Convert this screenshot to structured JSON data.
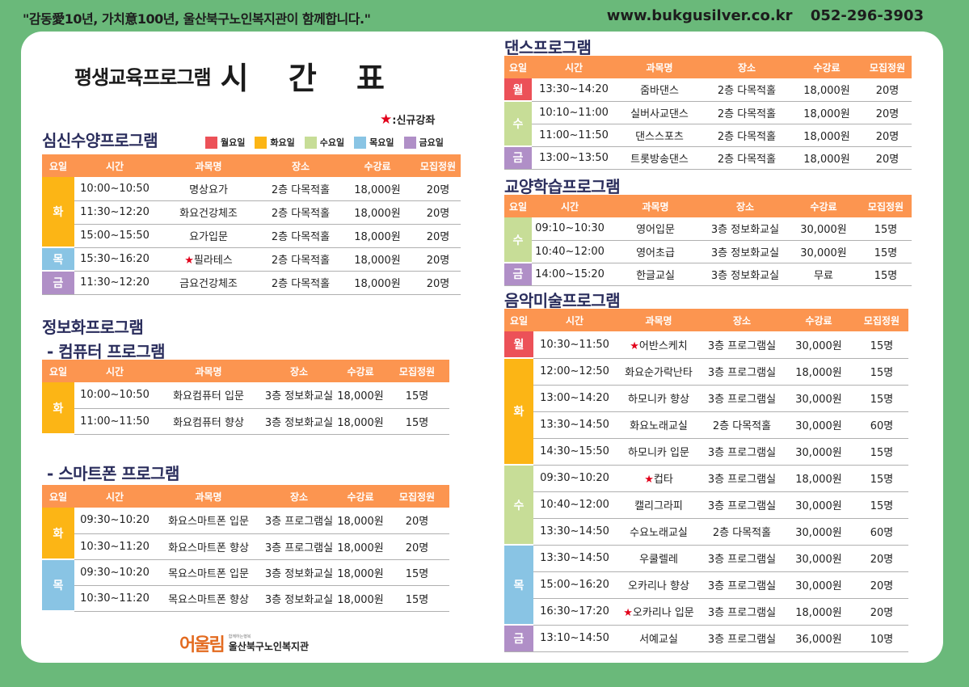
{
  "header": {
    "slogan": "\"감동愛10년, 가치意100년, 울산북구노인복지관이 함께합니다.\"",
    "website": "www.bukgusilver.co.kr",
    "phone": "052-296-3903"
  },
  "title": {
    "sub": "평생교육프로그램",
    "main": "시 간 표"
  },
  "new_note": {
    "star": "★",
    "label": ":신규강좌"
  },
  "legend": [
    {
      "label": "월요일",
      "color": "#ec5158"
    },
    {
      "label": "화요일",
      "color": "#fcb515"
    },
    {
      "label": "수요일",
      "color": "#c7dd97"
    },
    {
      "label": "목요일",
      "color": "#89c4e4"
    },
    {
      "label": "금요일",
      "color": "#b08fc7"
    }
  ],
  "columns": {
    "day": "요일",
    "time": "시간",
    "course": "과목명",
    "place": "장소",
    "fee": "수강료",
    "capacity": "모집정원"
  },
  "sections": {
    "mind_body": {
      "title": "심신수양프로그램",
      "groups": [
        {
          "day": "화",
          "color": "tue",
          "rows": [
            {
              "time": "10:00~10:50",
              "course": "명상요가",
              "place": "2층 다목적홀",
              "fee": "18,000원",
              "cap": "20명"
            },
            {
              "time": "11:30~12:20",
              "course": "화요건강체조",
              "place": "2층 다목적홀",
              "fee": "18,000원",
              "cap": "20명"
            },
            {
              "time": "15:00~15:50",
              "course": "요가입문",
              "place": "2층 다목적홀",
              "fee": "18,000원",
              "cap": "20명"
            }
          ]
        },
        {
          "day": "목",
          "color": "thu",
          "rows": [
            {
              "time": "15:30~16:20",
              "course": "필라테스",
              "new": true,
              "place": "2층 다목적홀",
              "fee": "18,000원",
              "cap": "20명"
            }
          ]
        },
        {
          "day": "금",
          "color": "fri",
          "rows": [
            {
              "time": "11:30~12:20",
              "course": "금요건강체조",
              "place": "2층 다목적홀",
              "fee": "18,000원",
              "cap": "20명"
            }
          ]
        }
      ]
    },
    "info": {
      "title": "정보화프로그램"
    },
    "computer": {
      "title": "- 컴퓨터 프로그램",
      "groups": [
        {
          "day": "화",
          "color": "tue",
          "rows": [
            {
              "time": "10:00~10:50",
              "course": "화요컴퓨터 입문",
              "place": "3층 정보화교실",
              "fee": "18,000원",
              "cap": "15명"
            },
            {
              "time": "11:00~11:50",
              "course": "화요컴퓨터 향상",
              "place": "3층 정보화교실",
              "fee": "18,000원",
              "cap": "15명"
            }
          ]
        }
      ]
    },
    "smartphone": {
      "title": "- 스마트폰 프로그램",
      "groups": [
        {
          "day": "화",
          "color": "tue",
          "rows": [
            {
              "time": "09:30~10:20",
              "course": "화요스마트폰 입문",
              "place": "3층 프로그램실",
              "fee": "18,000원",
              "cap": "20명"
            },
            {
              "time": "10:30~11:20",
              "course": "화요스마트폰 향상",
              "place": "3층 프로그램실",
              "fee": "18,000원",
              "cap": "20명"
            }
          ]
        },
        {
          "day": "목",
          "color": "thu",
          "rows": [
            {
              "time": "09:30~10:20",
              "course": "목요스마트폰 입문",
              "place": "3층 정보화교실",
              "fee": "18,000원",
              "cap": "15명"
            },
            {
              "time": "10:30~11:20",
              "course": "목요스마트폰 향상",
              "place": "3층 정보화교실",
              "fee": "18,000원",
              "cap": "15명"
            }
          ]
        }
      ]
    },
    "dance": {
      "title": "댄스프로그램",
      "groups": [
        {
          "day": "월",
          "color": "mon",
          "rows": [
            {
              "time": "13:30~14:20",
              "course": "줌바댄스",
              "place": "2층 다목적홀",
              "fee": "18,000원",
              "cap": "20명"
            }
          ]
        },
        {
          "day": "수",
          "color": "wed",
          "rows": [
            {
              "time": "10:10~11:00",
              "course": "실버사교댄스",
              "place": "2층 다목적홀",
              "fee": "18,000원",
              "cap": "20명"
            },
            {
              "time": "11:00~11:50",
              "course": "댄스스포츠",
              "place": "2층 다목적홀",
              "fee": "18,000원",
              "cap": "20명"
            }
          ]
        },
        {
          "day": "금",
          "color": "fri",
          "rows": [
            {
              "time": "13:00~13:50",
              "course": "트롯방송댄스",
              "place": "2층 다목적홀",
              "fee": "18,000원",
              "cap": "20명"
            }
          ]
        }
      ]
    },
    "culture": {
      "title": "교양학습프로그램",
      "groups": [
        {
          "day": "수",
          "color": "wed",
          "rows": [
            {
              "time": "09:10~10:30",
              "course": "영어입문",
              "place": "3층 정보화교실",
              "fee": "30,000원",
              "cap": "15명"
            },
            {
              "time": "10:40~12:00",
              "course": "영어초급",
              "place": "3층 정보화교실",
              "fee": "30,000원",
              "cap": "15명"
            }
          ]
        },
        {
          "day": "금",
          "color": "fri",
          "rows": [
            {
              "time": "14:00~15:20",
              "course": "한글교실",
              "place": "3층 정보화교실",
              "fee": "무료",
              "cap": "15명"
            }
          ]
        }
      ]
    },
    "music_art": {
      "title": "음악미술프로그램",
      "groups": [
        {
          "day": "월",
          "color": "mon",
          "rows": [
            {
              "time": "10:30~11:50",
              "course": "어반스케치",
              "new": true,
              "place": "3층 프로그램실",
              "fee": "30,000원",
              "cap": "15명"
            }
          ]
        },
        {
          "day": "화",
          "color": "tue",
          "rows": [
            {
              "time": "12:00~12:50",
              "course": "화요순가락난타",
              "place": "3층 프로그램실",
              "fee": "18,000원",
              "cap": "15명"
            },
            {
              "time": "13:00~14:20",
              "course": "하모니카 향상",
              "place": "3층 프로그램실",
              "fee": "30,000원",
              "cap": "15명"
            },
            {
              "time": "13:30~14:50",
              "course": "화요노래교실",
              "place": "2층 다목적홀",
              "fee": "30,000원",
              "cap": "60명"
            },
            {
              "time": "14:30~15:50",
              "course": "하모니카 입문",
              "place": "3층 프로그램실",
              "fee": "30,000원",
              "cap": "15명"
            }
          ]
        },
        {
          "day": "수",
          "color": "wed",
          "rows": [
            {
              "time": "09:30~10:20",
              "course": "컵타",
              "new": true,
              "place": "3층 프로그램실",
              "fee": "18,000원",
              "cap": "15명"
            },
            {
              "time": "10:40~12:00",
              "course": "캘리그라피",
              "place": "3층 프로그램실",
              "fee": "30,000원",
              "cap": "15명"
            },
            {
              "time": "13:30~14:50",
              "course": "수요노래교실",
              "place": "2층 다목적홀",
              "fee": "30,000원",
              "cap": "60명"
            }
          ]
        },
        {
          "day": "목",
          "color": "thu",
          "rows": [
            {
              "time": "13:30~14:50",
              "course": "우쿨렐레",
              "place": "3층 프로그램실",
              "fee": "30,000원",
              "cap": "20명"
            },
            {
              "time": "15:00~16:20",
              "course": "오카리나 향상",
              "place": "3층 프로그램실",
              "fee": "30,000원",
              "cap": "20명"
            },
            {
              "time": "16:30~17:20",
              "course": "오카리나 입문",
              "new": true,
              "place": "3층 프로그램실",
              "fee": "18,000원",
              "cap": "20명"
            }
          ]
        },
        {
          "day": "금",
          "color": "fri",
          "rows": [
            {
              "time": "13:10~14:50",
              "course": "서예교실",
              "place": "3층 프로그램실",
              "fee": "36,000원",
              "cap": "10명"
            }
          ]
        }
      ]
    }
  },
  "logo": {
    "mark": "어울림",
    "tagline": "함께하는행복",
    "name": "울산북구노인복지관"
  }
}
